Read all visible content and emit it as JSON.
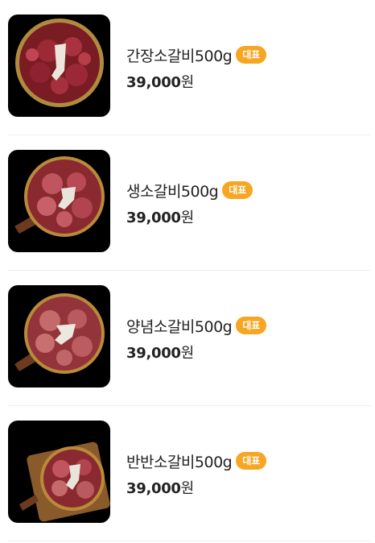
{
  "menu": {
    "items": [
      {
        "name": "간장소갈비500g",
        "badge": "대표",
        "price": "39,000",
        "currency": "원",
        "photo_icon": "marinated-short-rib-photo"
      },
      {
        "name": "생소갈비500g",
        "badge": "대표",
        "price": "39,000",
        "currency": "원",
        "photo_icon": "raw-short-rib-photo"
      },
      {
        "name": "양념소갈비500g",
        "badge": "대표",
        "price": "39,000",
        "currency": "원",
        "photo_icon": "seasoned-short-rib-photo"
      },
      {
        "name": "반반소갈비500g",
        "badge": "대표",
        "price": "39,000",
        "currency": "원",
        "photo_icon": "half-half-short-rib-photo"
      }
    ]
  },
  "colors": {
    "badge": "#f6a623",
    "divider": "#eeeeee",
    "thumb_bg": "#000000"
  }
}
